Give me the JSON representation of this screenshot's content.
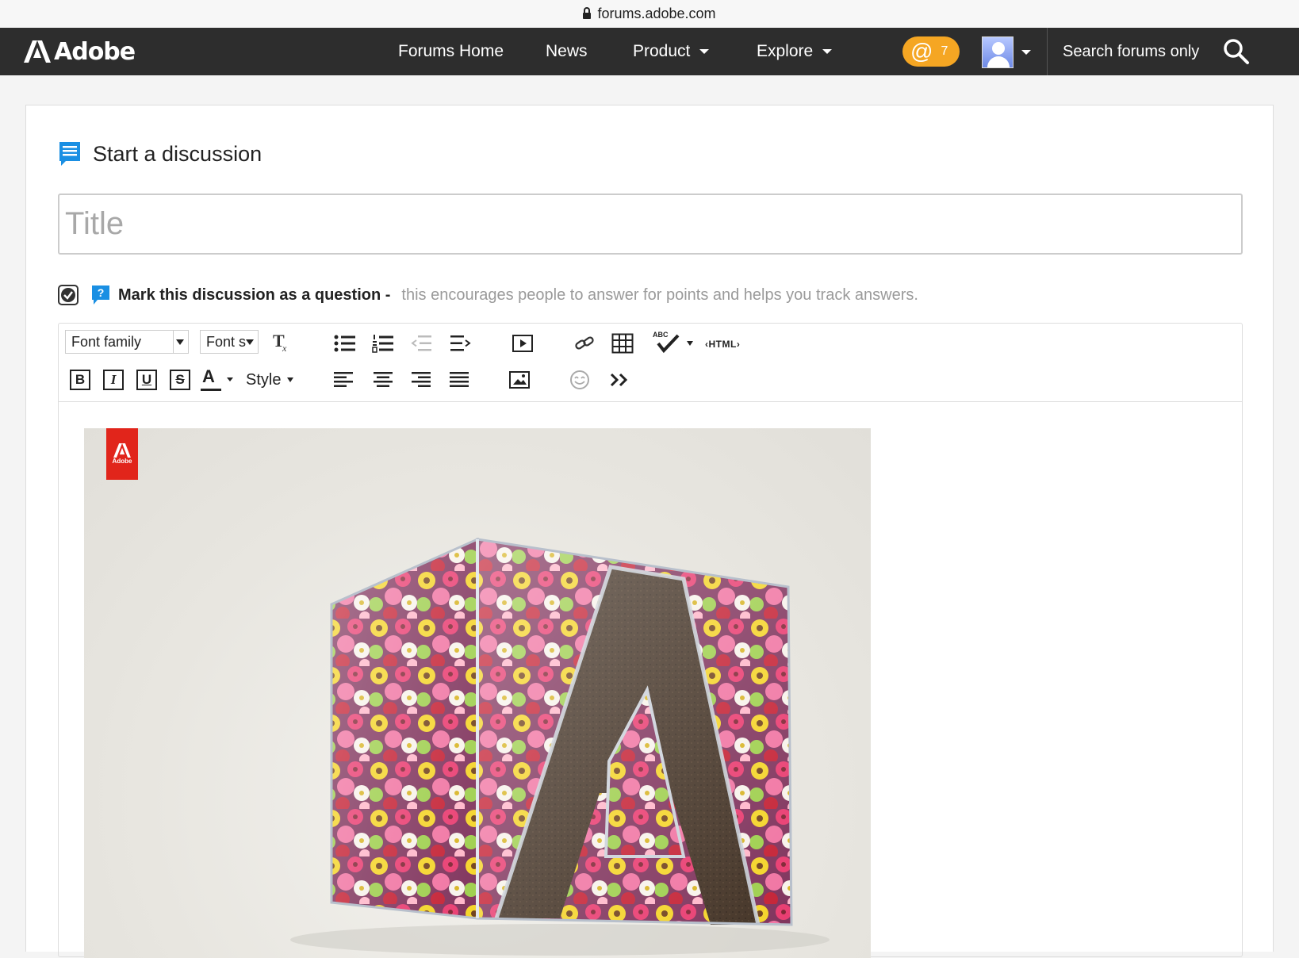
{
  "browser": {
    "url": "forums.adobe.com"
  },
  "nav": {
    "brand": "Adobe",
    "items": [
      {
        "label": "Forums Home",
        "dropdown": false
      },
      {
        "label": "News",
        "dropdown": false
      },
      {
        "label": "Product",
        "dropdown": true
      },
      {
        "label": "Explore",
        "dropdown": true
      }
    ],
    "mentions_count": "7",
    "search_label": "Search forums only"
  },
  "page": {
    "heading": "Start a discussion",
    "title_placeholder": "Title",
    "question": {
      "checked": true,
      "label": "Mark this discussion as a question -",
      "hint": "this encourages people to answer for points and helps you track answers."
    }
  },
  "editor": {
    "font_family": "Font family",
    "font_size": "Font s",
    "style_label": "Style",
    "html_label": "‹HTML›",
    "format_buttons": [
      "B",
      "I",
      "U",
      "S"
    ]
  },
  "image": {
    "logo_text": "Adobe"
  },
  "colors": {
    "nav_bg": "#2d2d2d",
    "accent_orange": "#f5a623",
    "adobe_red": "#e1251b",
    "link_blue": "#1a8fe3"
  }
}
